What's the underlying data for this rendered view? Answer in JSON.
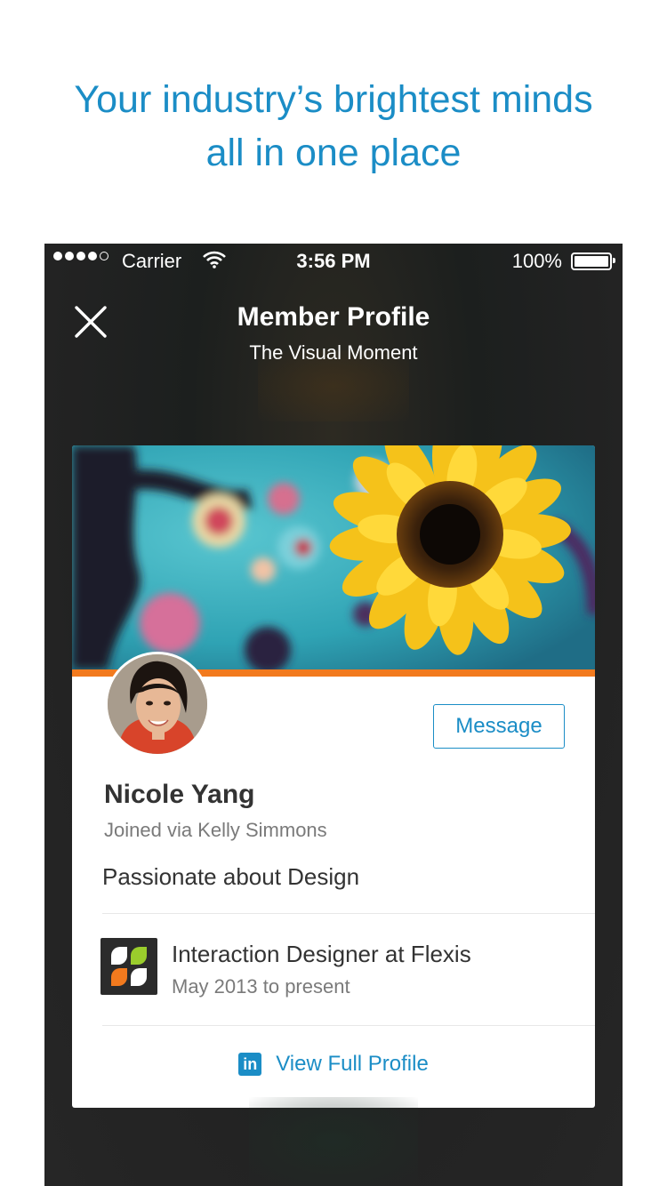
{
  "tagline": {
    "line1": "Your industry’s brightest minds",
    "line2": "all in one place"
  },
  "statusbar": {
    "carrier": "Carrier",
    "time": "3:56 PM",
    "battery": "100%"
  },
  "nav": {
    "title": "Member Profile",
    "subtitle": "The Visual Moment"
  },
  "profile": {
    "message_label": "Message",
    "name": "Nicole Yang",
    "joined": "Joined via Kelly Simmons",
    "bio": "Passionate about Design",
    "position": {
      "title": "Interaction Designer at Flexis",
      "dates": "May 2013 to present"
    },
    "view_full_label": "View Full Profile"
  },
  "colors": {
    "accent": "#1b8dc6",
    "cover_bar": "#f27a1e",
    "card_bg": "#ffffff"
  },
  "icons": {
    "close": "close-icon",
    "wifi": "wifi-icon",
    "linkedin": "linkedin-icon",
    "company": "flexis-logo-icon"
  }
}
